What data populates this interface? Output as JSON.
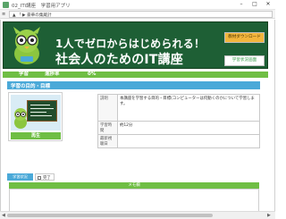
{
  "window": {
    "title": "02_ITi講座　学習用アプリ",
    "minimize": "–",
    "maximize": "□",
    "close": "✕"
  },
  "address": {
    "menu_glyph": "≡",
    "text": "▲ 「 ▶ 豪華の集蔵計"
  },
  "banner": {
    "line1": "1人でゼロからはじめられる！",
    "line2": "社会人のためのIT講座",
    "download_label": "教材ダウンロード",
    "status_label": "学習状況画面"
  },
  "progress": {
    "label1": "学習",
    "label2": "進捗率",
    "value": "0%",
    "fraction": 0
  },
  "section": {
    "title": "学習の目的・目標"
  },
  "video": {
    "play_label": "再生"
  },
  "info": {
    "rows": [
      {
        "label": "説明",
        "value": "本講座を学習する目的・目標(コンピューターは何動くのかについて学習します。"
      },
      {
        "label": "学習時間",
        "value": "約12分"
      },
      {
        "label": "最新視聴日",
        "value": ""
      }
    ]
  },
  "status": {
    "label": "学習状況",
    "check_label": "完了"
  },
  "memo": {
    "title": "メモ欄"
  },
  "colors": {
    "banner": "#1e5f35",
    "green": "#6fbe44",
    "blue": "#4aa9d8",
    "orange": "#f2b53c"
  }
}
